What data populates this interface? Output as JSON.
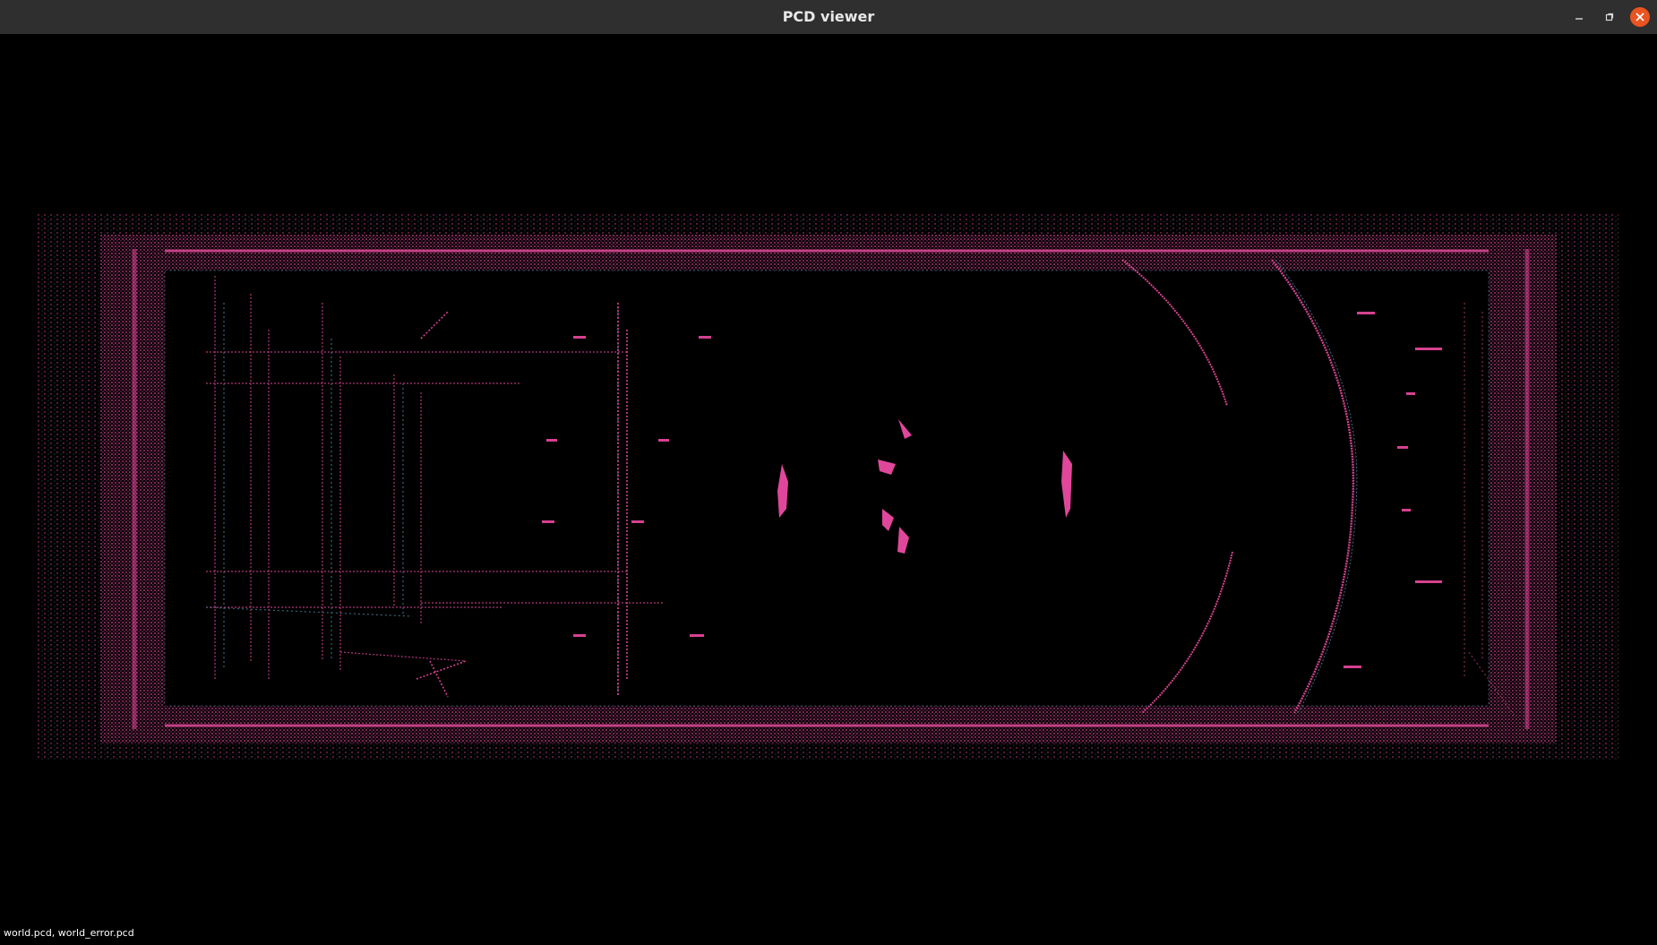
{
  "window": {
    "title": "PCD viewer",
    "controls": {
      "minimize_icon": "minimize-icon",
      "maximize_icon": "restore-icon",
      "close_icon": "close-icon"
    }
  },
  "viewer": {
    "background": "#000000",
    "cloud_colors": {
      "primary": "#d6418f",
      "secondary": "#3e6f86"
    },
    "loaded_files_text": "world.pcd, world_error.pcd"
  },
  "colors": {
    "titlebar": "#2f2f2f",
    "close_button": "#e95420"
  }
}
